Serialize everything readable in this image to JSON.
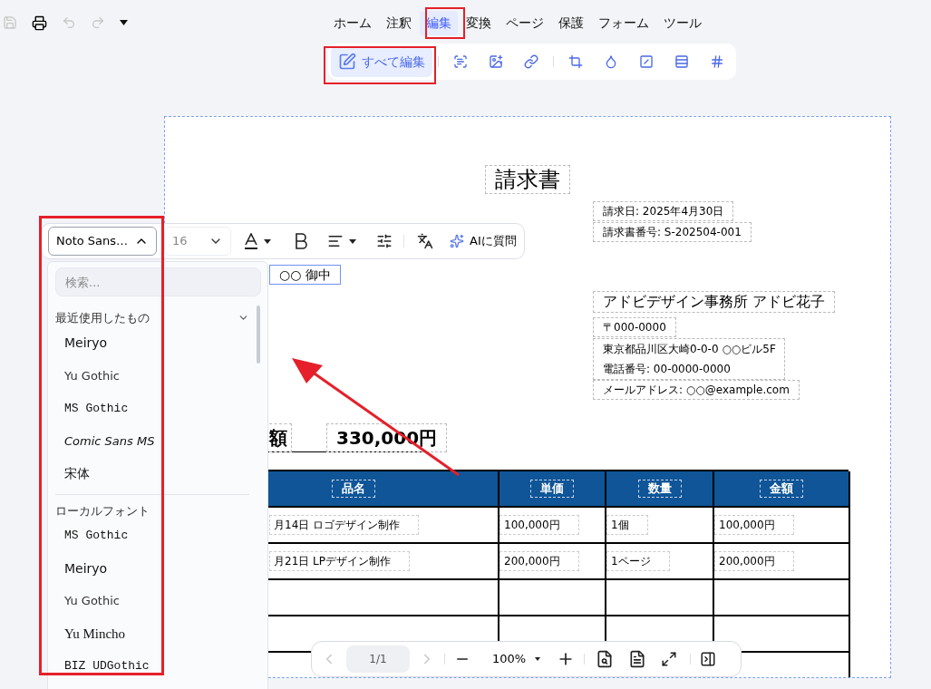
{
  "quick_access": {
    "save_disabled": true,
    "undo_disabled": true,
    "redo_disabled": true
  },
  "menu_tabs": [
    {
      "label": "ホーム",
      "selected": false
    },
    {
      "label": "注釈",
      "selected": false
    },
    {
      "label": "編集",
      "selected": true
    },
    {
      "label": "変換",
      "selected": false
    },
    {
      "label": "ページ",
      "selected": false
    },
    {
      "label": "保護",
      "selected": false
    },
    {
      "label": "フォーム",
      "selected": false
    },
    {
      "label": "ツール",
      "selected": false
    }
  ],
  "edit_toolbar": {
    "edit_all": {
      "label": "すべて編集",
      "selected": true
    }
  },
  "text_toolbar": {
    "font": "Noto Sans…",
    "font_menu_expanded": true,
    "size": "16",
    "ai_button": "AIに質問"
  },
  "font_menu": {
    "search_placeholder": "検索...",
    "sections": [
      {
        "title": "最近使用したもの",
        "items": [
          {
            "name": "Meiryo",
            "kind": "sans"
          },
          {
            "name": "Yu Gothic",
            "kind": "light"
          },
          {
            "name": "MS Gothic",
            "kind": "mono"
          },
          {
            "name": "Comic Sans MS",
            "kind": "italic"
          },
          {
            "name": "宋体",
            "kind": "sans"
          }
        ]
      },
      {
        "title": "ローカルフォント",
        "items": [
          {
            "name": "MS Gothic",
            "kind": "mono"
          },
          {
            "name": "Meiryo",
            "kind": "sans"
          },
          {
            "name": "Yu Gothic",
            "kind": "light"
          },
          {
            "name": "Yu Mincho",
            "kind": "serif"
          },
          {
            "name": "BIZ UDGothic",
            "kind": "mono"
          }
        ]
      }
    ]
  },
  "document": {
    "title": "請求書",
    "date": "請求日: 2025年4月30日",
    "number": "請求書番号: S-202504-001",
    "recipient": "○○ 御中",
    "sender": "アドビデザイン事務所 アドビ花子",
    "postal": "〒000-0000",
    "address": "東京都品川区大崎0-0-0 ○○ビル5F",
    "phone": "電話番号: 00-0000-0000",
    "email": "メールアドレス: ○○@example.com",
    "total_label": "額",
    "total": "330,000円",
    "table": {
      "columns": [
        "品名",
        "単価",
        "数量",
        "金額"
      ],
      "rows": [
        [
          "月14日 ロゴデザイン制作",
          "100,000円",
          "1個",
          "100,000円"
        ],
        [
          "月21日 LPデザイン制作",
          "200,000円",
          "1ページ",
          "200,000円"
        ]
      ]
    }
  },
  "page_bar": {
    "page": "1/1",
    "zoom": "100%"
  }
}
